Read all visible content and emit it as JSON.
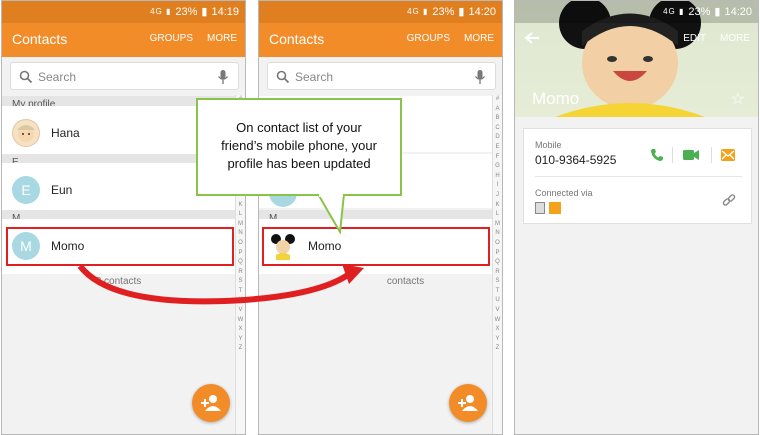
{
  "screen1": {
    "status": {
      "battery": "23%",
      "time": "14:19"
    },
    "title": "Contacts",
    "actions": [
      "GROUPS",
      "MORE"
    ],
    "search_placeholder": "Search",
    "sections": [
      "My profile",
      "E",
      "M"
    ],
    "contacts": [
      "Hana",
      "Eun",
      "Momo"
    ],
    "avatar_letters": [
      "E",
      "M"
    ],
    "footer": "3 contacts"
  },
  "screen2": {
    "status": {
      "battery": "23%",
      "time": "14:20"
    },
    "title": "Contacts",
    "actions": [
      "GROUPS",
      "MORE"
    ],
    "search_placeholder": "Search",
    "sections": [
      "M"
    ],
    "contacts": [
      "Momo"
    ],
    "footer": "contacts"
  },
  "screen3": {
    "status": {
      "battery": "23%",
      "time": "14:20"
    },
    "actions": [
      "EDIT",
      "MORE"
    ],
    "name": "Momo",
    "mobile_label": "Mobile",
    "phone": "010-9364-5925",
    "connected_label": "Connected via"
  },
  "callout": {
    "lines": [
      "On contact list of your",
      "friend’s  mobile phone, your",
      "profile has been updated"
    ]
  },
  "index_letters": [
    "#",
    "A",
    "B",
    "C",
    "D",
    "E",
    "F",
    "G",
    "H",
    "I",
    "J",
    "K",
    "L",
    "M",
    "N",
    "O",
    "P",
    "Q",
    "R",
    "S",
    "T",
    "U",
    "V",
    "W",
    "X",
    "Y",
    "Z"
  ],
  "colors": {
    "appbar": "#f28c28",
    "statusbar": "#e07f1f",
    "highlight": "#e02020",
    "callout_border": "#8ac34a",
    "call": "#4caf50",
    "message": "#f2a21b"
  }
}
